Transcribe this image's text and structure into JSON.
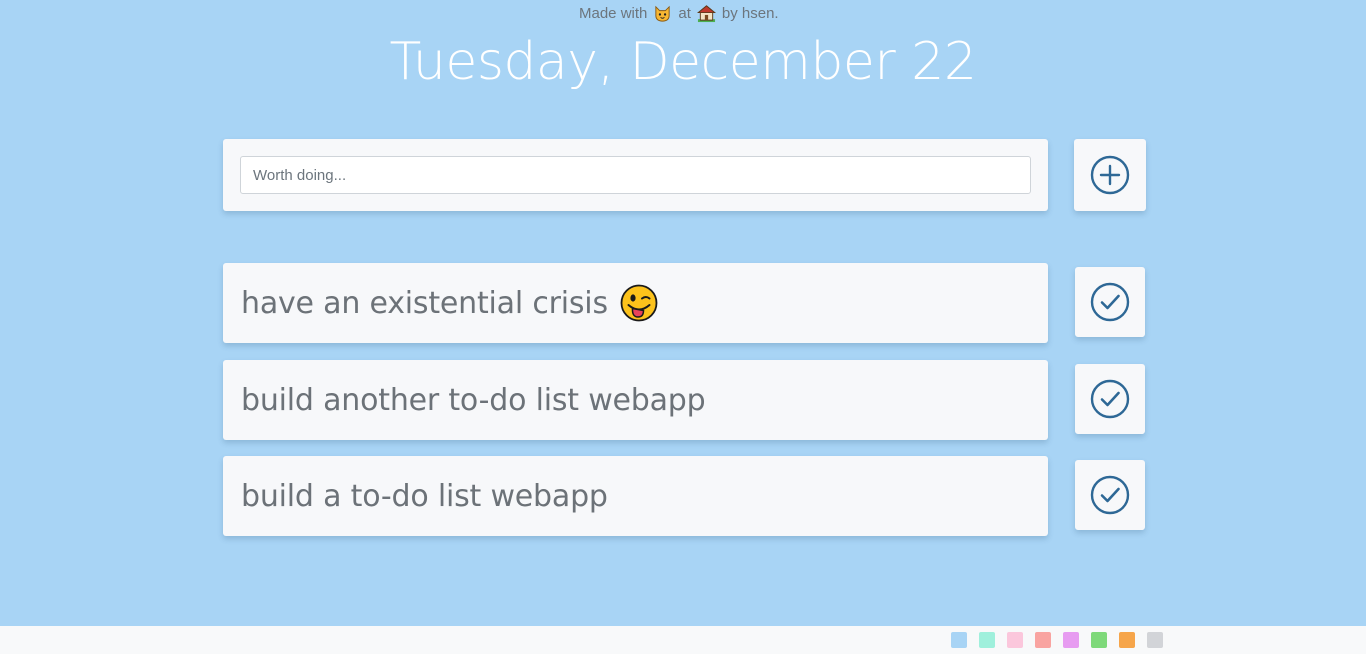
{
  "header": {
    "date": "Tuesday, December 22"
  },
  "new_todo": {
    "placeholder": "Worth doing...",
    "value": "",
    "add_icon": "plus-circle-icon"
  },
  "todos": [
    {
      "text": "have an existential crisis",
      "emoji": "winking-face-with-tongue-emoji",
      "done_icon": "check-circle-icon"
    },
    {
      "text": "build another to-do list webapp",
      "done_icon": "check-circle-icon"
    },
    {
      "text": "build a to-do list webapp",
      "done_icon": "check-circle-icon"
    }
  ],
  "footer": {
    "made_with": "Made with",
    "at": "at",
    "by": "by hsen.",
    "made_with_icon": "cat-face-emoji",
    "at_icon": "house-emoji"
  },
  "theme_swatches": [
    "#a8d4f5",
    "#9ff0dc",
    "#fbc7dc",
    "#f9a4a1",
    "#e79cf1",
    "#7ed97a",
    "#f6a54a",
    "#d2d4d8"
  ],
  "colors": {
    "background": "#a8d4f5",
    "card": "#f7f8fa",
    "icon": "#2e6896",
    "text": "#6c7278"
  }
}
